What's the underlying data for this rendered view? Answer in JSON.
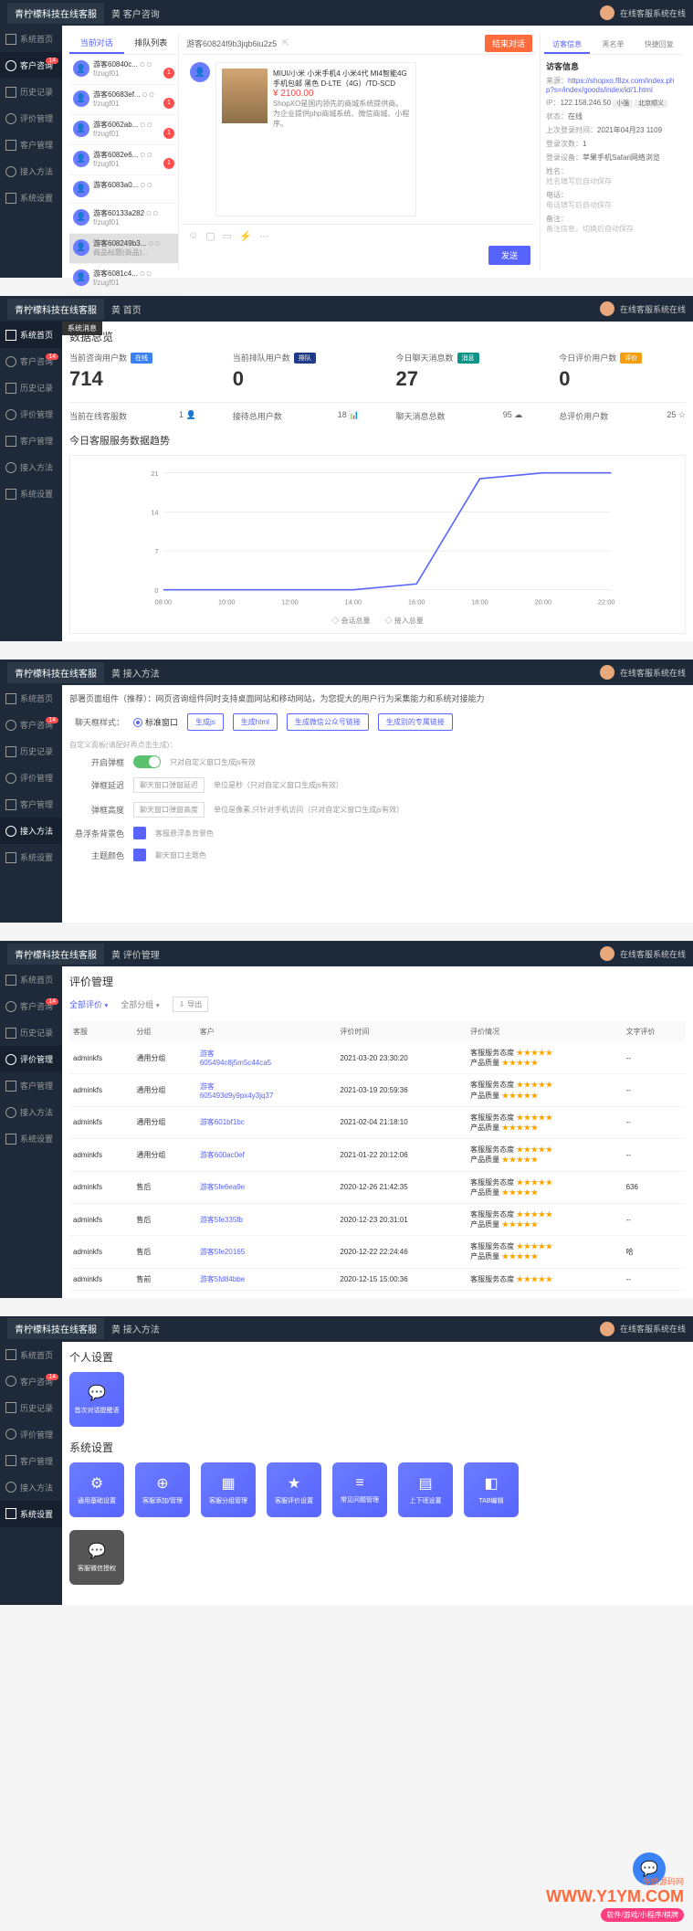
{
  "brand": "青柠檬科技在线客服",
  "status_online": "在线客服系统在线",
  "nav": [
    {
      "label": "系统首页",
      "badge": null
    },
    {
      "label": "客户咨询",
      "badge": "14"
    },
    {
      "label": "历史记录",
      "badge": null
    },
    {
      "label": "评价管理",
      "badge": null
    },
    {
      "label": "客户管理",
      "badge": null
    },
    {
      "label": "接入方法",
      "badge": null
    },
    {
      "label": "系统设置",
      "badge": null
    }
  ],
  "p1": {
    "crumb": "黄 客户咨询",
    "tabs": {
      "cur": "当前对话",
      "queue": "排队列表"
    },
    "visitor_id": "游客60824f9b3jqb6iu2z5",
    "end_btn": "结束对话",
    "convos": [
      {
        "name": "游客60840c...",
        "time": "O O",
        "from": "f/zugf01",
        "badge": "1"
      },
      {
        "name": "游客60683ef...",
        "time": "O O",
        "from": "f/zugf01",
        "badge": "1"
      },
      {
        "name": "游客6062ab...",
        "time": "O O",
        "from": "f/zugf01",
        "badge": "1"
      },
      {
        "name": "游客6082e6...",
        "time": "O O",
        "from": "f/zugf01",
        "badge": "1"
      },
      {
        "name": "游客6083a0...",
        "time": "O O",
        "from": "",
        "badge": null
      },
      {
        "name": "游客60133a282",
        "time": "O O",
        "from": "f/zugf01",
        "badge": null
      },
      {
        "name": "游客608249b3...",
        "time": "O O",
        "from": "商品标题(商品)...",
        "badge": null,
        "sel": true
      },
      {
        "name": "游客6081c4...",
        "time": "O O",
        "from": "f/zugf01",
        "badge": null
      }
    ],
    "product": {
      "title": "MIUI/小米 小米手机4 小米4代 MI4智能4G手机包邮 黑色 D-LTE（4G）/TD-SCD",
      "price": "¥ 2100.00",
      "desc1": "ShopXO是国内领先的商城系统提供商。",
      "desc2": "为企业提供php商城系统、微信商城、小程序。"
    },
    "send": "发送",
    "info_tabs": [
      "访客信息",
      "黑名单",
      "快捷回复"
    ],
    "info_title": "访客信息",
    "info": {
      "source_lbl": "来源：",
      "source": "https://shopxo.f8zx.com/index.php?s=/index/goods/index/id/1.html",
      "ip_lbl": "IP：",
      "ip": "122.158.246.50",
      "ip_tags": [
        "小强",
        "北京顺义"
      ],
      "status_lbl": "状态：",
      "status": "在线",
      "lastlogin_lbl": "上次登录时间：",
      "lastlogin": "2021年04月23 1109",
      "count_lbl": "登录次数：",
      "count": "1",
      "device_lbl": "登录设备：",
      "device": "苹果手机Safari网络浏览",
      "name_lbl": "姓名：",
      "name_hint": "姓名填写后自动保存",
      "phone_lbl": "电话：",
      "phone_hint": "电话填写后自动保存",
      "note_lbl": "备注：",
      "note_hint": "备注信息，切换后自动保存"
    }
  },
  "p2": {
    "crumb": "黄 首页",
    "sysmsg": "系统消息",
    "title": "数据总览",
    "stats": [
      {
        "label": "当前咨询用户数",
        "chip": "在线",
        "chipc": "blue",
        "num": "714"
      },
      {
        "label": "当前排队用户数",
        "chip": "排队",
        "chipc": "navy",
        "num": "0"
      },
      {
        "label": "今日聊天消息数",
        "chip": "消息",
        "chipc": "teal",
        "num": "27"
      },
      {
        "label": "今日评价用户数",
        "chip": "评价",
        "chipc": "amber",
        "num": "0"
      }
    ],
    "subs": [
      {
        "l": "当前在线客服数",
        "v": "1 👤"
      },
      {
        "l": "接待总用户数",
        "v": "18 📊"
      },
      {
        "l": "聊天消息总数",
        "v": "95 ☁"
      },
      {
        "l": "总评价用户数",
        "v": "25 ☆"
      }
    ],
    "chart_title": "今日客服服务数据趋势",
    "legend": [
      "◇ 会话总量",
      "◇ 接入总量"
    ],
    "xticks": [
      "08:00",
      "10:00",
      "12:00",
      "14:00",
      "16:00",
      "18:00",
      "20:00",
      "22:00"
    ],
    "yticks": [
      "21",
      "14",
      "7",
      "0"
    ]
  },
  "chart_data": {
    "type": "line",
    "x": [
      "08:00",
      "10:00",
      "12:00",
      "14:00",
      "16:00",
      "18:00",
      "20:00",
      "22:00"
    ],
    "series": [
      {
        "name": "会话总量",
        "values": [
          0,
          0,
          0,
          0,
          1,
          20,
          21,
          21
        ]
      },
      {
        "name": "接入总量",
        "values": [
          0,
          0,
          0,
          0,
          1,
          20,
          21,
          21
        ]
      }
    ],
    "ylim": [
      0,
      21
    ],
    "xlabel": "",
    "ylabel": "",
    "title": "今日客服服务数据趋势"
  },
  "p3": {
    "crumb": "黄 接入方法",
    "desc": "部署页面组件（推荐）：网页咨询组件同时支持桌面网站和移动网站，为您提大的用户行为采集能力和系统对接能力",
    "mode_lbl": "聊天框样式：",
    "mode_opt": "标准窗口",
    "btns": [
      "生成js",
      "生成html",
      "生成微信公众号链接",
      "生成别的专属链接"
    ],
    "note": "自定义面板(请配好再点击生成)：",
    "rows": [
      {
        "l": "开启弹框",
        "type": "switch",
        "hint": "只对自定义窗口生成js有效"
      },
      {
        "l": "弹框延迟",
        "type": "input",
        "val": "聊天窗口弹窗延迟",
        "hint": "单位是秒（只对自定义窗口生成js有效）"
      },
      {
        "l": "弹框高度",
        "type": "input",
        "val": "聊天窗口弹窗高度",
        "hint": "单位是像素,只针对手机访问（只对自定义窗口生成js有效）"
      },
      {
        "l": "悬浮条背景色",
        "type": "color",
        "hint": "客服悬浮条背景色"
      },
      {
        "l": "主题颜色",
        "type": "color",
        "hint": "聊天窗口主题色"
      }
    ]
  },
  "p4": {
    "crumb": "黄 评价管理",
    "title": "评价管理",
    "tabs": [
      "全部评价",
      "全部分组"
    ],
    "export": "导出",
    "cols": [
      "客服",
      "分组",
      "客户",
      "评价时间",
      "评价情况",
      "文字评价"
    ],
    "rows": [
      {
        "s": "adminkfs",
        "g": "通用分组",
        "c": "游客\n605494c8j5m5c44ca5",
        "t": "2021-03-20 23:30:20",
        "e": "客服服务态度 ★★★★★\n产品质量 ★★★★★",
        "w": "--"
      },
      {
        "s": "adminkfs",
        "g": "通用分组",
        "c": "游客\n605493d9y9px4y3jq37",
        "t": "2021-03-19 20:59:36",
        "e": "客服服务态度 ★★★★★\n产品质量 ★★★★★",
        "w": "--"
      },
      {
        "s": "adminkfs",
        "g": "通用分组",
        "c": "游客601bf1bc",
        "t": "2021-02-04 21:18:10",
        "e": "客服服务态度 ★★★★★\n产品质量 ★★★★★",
        "w": "--"
      },
      {
        "s": "adminkfs",
        "g": "通用分组",
        "c": "游客600ac0ef",
        "t": "2021-01-22 20:12:06",
        "e": "客服服务态度 ★★★★★\n产品质量 ★★★★★",
        "w": "--"
      },
      {
        "s": "adminkfs",
        "g": "售后",
        "c": "游客5fe6ea9e",
        "t": "2020-12-26 21:42:35",
        "e": "客服服务态度 ★★★★★\n产品质量 ★★★★★",
        "w": "636"
      },
      {
        "s": "adminkfs",
        "g": "售后",
        "c": "游客5fe335fb",
        "t": "2020-12-23 20:31:01",
        "e": "客服服务态度 ★★★★★\n产品质量 ★★★★★",
        "w": "--"
      },
      {
        "s": "adminkfs",
        "g": "售后",
        "c": "游客5fe20165",
        "t": "2020-12-22 22:24:46",
        "e": "客服服务态度 ★★★★★\n产品质量 ★★★★★",
        "w": "哈"
      },
      {
        "s": "adminkfs",
        "g": "售前",
        "c": "游客5fd84bbe",
        "t": "2020-12-15 15:00:36",
        "e": "客服服务态度 ★★★★★",
        "w": "--"
      }
    ]
  },
  "p5": {
    "crumb": "黄 接入方法",
    "personal": "个人设置",
    "ptiles": [
      {
        "icon": "💬",
        "label": "首次对话提醒语"
      }
    ],
    "system": "系统设置",
    "stiles": [
      {
        "icon": "⚙",
        "label": "通用基础设置"
      },
      {
        "icon": "⊕",
        "label": "客服添加/管理"
      },
      {
        "icon": "▦",
        "label": "客服分组管理"
      },
      {
        "icon": "★",
        "label": "客服评价设置"
      },
      {
        "icon": "≡",
        "label": "常见问题管理"
      },
      {
        "icon": "▤",
        "label": "上下班设置"
      },
      {
        "icon": "◧",
        "label": "TAB编辑"
      }
    ],
    "gtile": {
      "icon": "💬",
      "label": "客服微信授权"
    }
  },
  "wm": {
    "t1": "依依源码网",
    "t2": "WWW.Y1YM.COM",
    "t3": "软件/游戏/小程序/棋牌"
  }
}
